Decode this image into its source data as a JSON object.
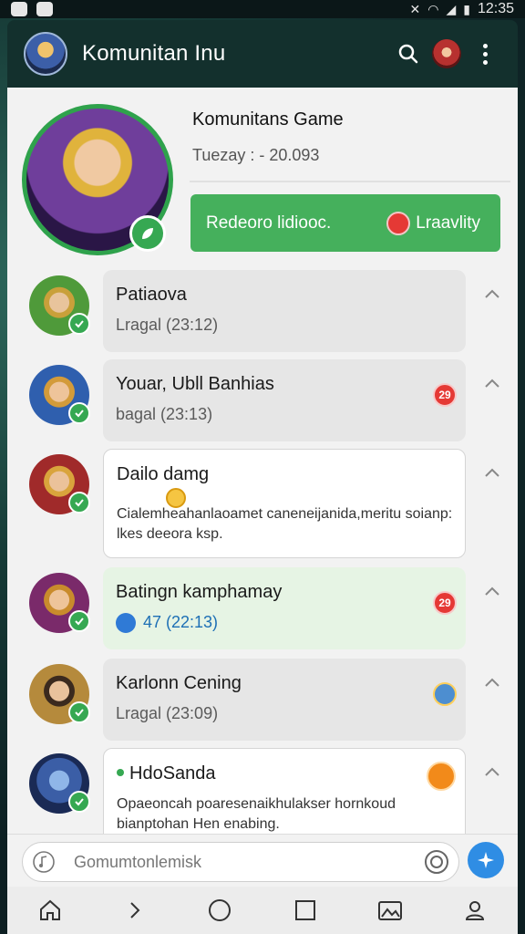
{
  "status_bar": {
    "time": "12:35"
  },
  "app_bar": {
    "title": "Komunitan Inu"
  },
  "hero": {
    "title": "Komunitans Game",
    "date": "Tuezay : - 20.093",
    "button_label": "Redeoro lidiooc.",
    "button_right_label": "Lraavlity"
  },
  "items": [
    {
      "name": "Patiaova",
      "sub": "Lragal (23:12)"
    },
    {
      "name": "Youar, Ubll Banhias",
      "sub": "bagal (23:13)",
      "badge": "29"
    },
    {
      "name": "Dailo damg",
      "desc": "Cialemheahanlaoamet caneneijanida,meritu soianp: lkes deeora ksp."
    },
    {
      "name": "Batingn kamphamay",
      "sub": "47 (22:13)",
      "badge": "29"
    },
    {
      "name": "Karlonn Cening",
      "sub": "Lragal (23:09)"
    },
    {
      "name": "HdoSanda",
      "desc": "Opaeoncah poaresenaikhulakser hornkoud bianptohan Hen enabing."
    }
  ],
  "composer": {
    "placeholder": "Gomumtonlemisk"
  },
  "colors": {
    "accent_green": "#45b05c",
    "send_blue": "#2f8de4",
    "header_dark": "#13302d"
  }
}
